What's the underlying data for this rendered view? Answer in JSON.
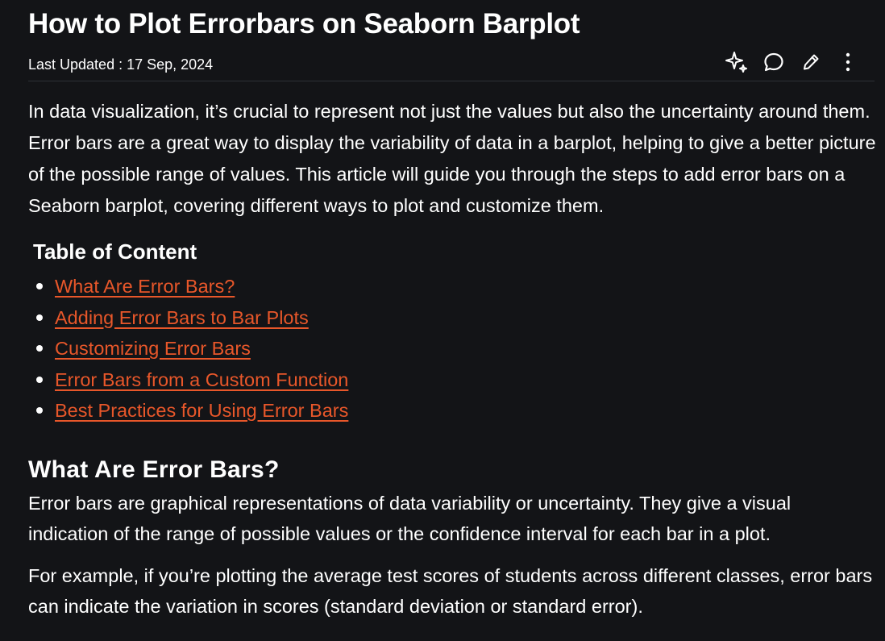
{
  "article": {
    "title": "How to Plot Errorbars on Seaborn Barplot",
    "last_updated": "Last Updated : 17 Sep, 2024",
    "intro": "In data visualization, it’s crucial to represent not just the values but also the uncertainty around them. Error bars are a great way to display the variability of data in a barplot, helping to give a better picture of the possible range of values. This article will guide you through the steps to add error bars on a Seaborn barplot, covering different ways to plot and customize them."
  },
  "actions": {
    "icons": [
      "ai-sparkle-icon",
      "comment-icon",
      "edit-pencil-icon",
      "more-vertical-icon"
    ]
  },
  "toc": {
    "title": "Table of Content",
    "items": [
      {
        "label": "What Are Error Bars?"
      },
      {
        "label": "Adding Error Bars to Bar Plots"
      },
      {
        "label": "Customizing Error Bars"
      },
      {
        "label": "Error Bars from a Custom Function"
      },
      {
        "label": "Best Practices for Using Error Bars"
      }
    ]
  },
  "section1": {
    "heading": "What Are Error Bars?",
    "paragraphs": [
      "Error bars are graphical representations of data variability or uncertainty. They give a visual indication of the range of possible values or the confidence interval for each bar in a plot.",
      "For example, if you’re plotting the average test scores of students across different classes, error bars can indicate the variation in scores (standard deviation or standard error)."
    ]
  },
  "colors": {
    "background": "#131417",
    "text": "#ffffff",
    "link": "#e8572a",
    "divider": "#2e3036"
  }
}
